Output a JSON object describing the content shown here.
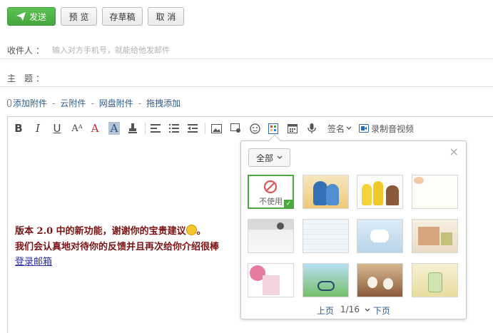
{
  "actions": {
    "send_label": "发送",
    "preview_label": "预 览",
    "draft_label": "存草稿",
    "cancel_label": "取 消"
  },
  "recipient": {
    "label": "收件人 ：",
    "placeholder": "输入对方手机号，就能给他发邮件"
  },
  "subject": {
    "label": "主　题 ："
  },
  "attachments": {
    "items": [
      "添加附件",
      "云附件",
      "网盘附件",
      "拖拽添加"
    ],
    "separator": "-"
  },
  "toolbar": {
    "bold": "B",
    "italic": "I",
    "underline": "U",
    "font_size": "Aᴬ",
    "font_color": "A",
    "highlight": "A",
    "signature_label": "签名",
    "record_label": "录制音视频"
  },
  "body": {
    "line1": "版本 2.0 中的新功能，谢谢你的宝贵建议",
    "line1_end": "。",
    "line2": "我们会认真地对待你的反馈并且再次给你介绍很棒",
    "link": "登录邮箱"
  },
  "stationery": {
    "filter_label": "全部",
    "none_label": "不使用",
    "close": "×",
    "prev_label": "上页",
    "page_info": "1/16",
    "next_label": "下页",
    "thumbnails": [
      "none",
      "blue-parrots",
      "minions",
      "sketch-flowers",
      "gray-sketch",
      "light-blue-lined",
      "white-horse",
      "watercolor-church",
      "pink-girl",
      "girl-on-bicycle",
      "snowmen",
      "jar-leaves"
    ]
  },
  "colors": {
    "send_green": "#4caf43",
    "link_blue": "#2d5d8c",
    "body_red": "#7b1111",
    "selected_border": "#4aa83c"
  }
}
